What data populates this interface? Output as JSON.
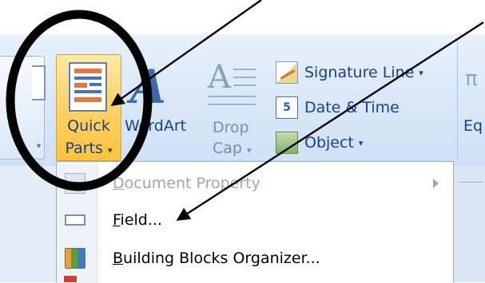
{
  "ribbon": {
    "quick_parts": {
      "line1": "Quick",
      "line2": "Parts",
      "arrow": "▾",
      "icon": "quick-parts-icon"
    },
    "wordart": {
      "label": "WordArt",
      "icon": "wordart-icon"
    },
    "drop_cap": {
      "line1": "Drop",
      "line2": "Cap",
      "arrow": "▾",
      "icon": "drop-cap-icon",
      "letter": "A"
    },
    "small_buttons": [
      {
        "label": "Signature Line",
        "arrow": "▾",
        "icon": "signature-line-icon"
      },
      {
        "label": "Date & Time",
        "icon": "date-time-icon",
        "icon_text": "5"
      },
      {
        "label": "Object",
        "arrow": "▾",
        "icon": "object-icon"
      }
    ],
    "equation_fragment": "Eq"
  },
  "menu": {
    "items": [
      {
        "pre": "",
        "underline": "D",
        "post": "ocument Property",
        "disabled": true,
        "submenu": true,
        "icon": "document-property-icon"
      },
      {
        "pre": "",
        "underline": "F",
        "post": "ield...",
        "disabled": false,
        "submenu": false,
        "icon": "field-icon"
      },
      {
        "pre": "",
        "underline": "B",
        "post": "uilding Blocks Organizer...",
        "disabled": false,
        "submenu": false,
        "icon": "building-blocks-icon"
      }
    ]
  },
  "colors": {
    "ribbon_text": "#15428b",
    "highlight": "#ffd46a",
    "disabled_text": "#9da6b3",
    "annotation": "#000000"
  }
}
